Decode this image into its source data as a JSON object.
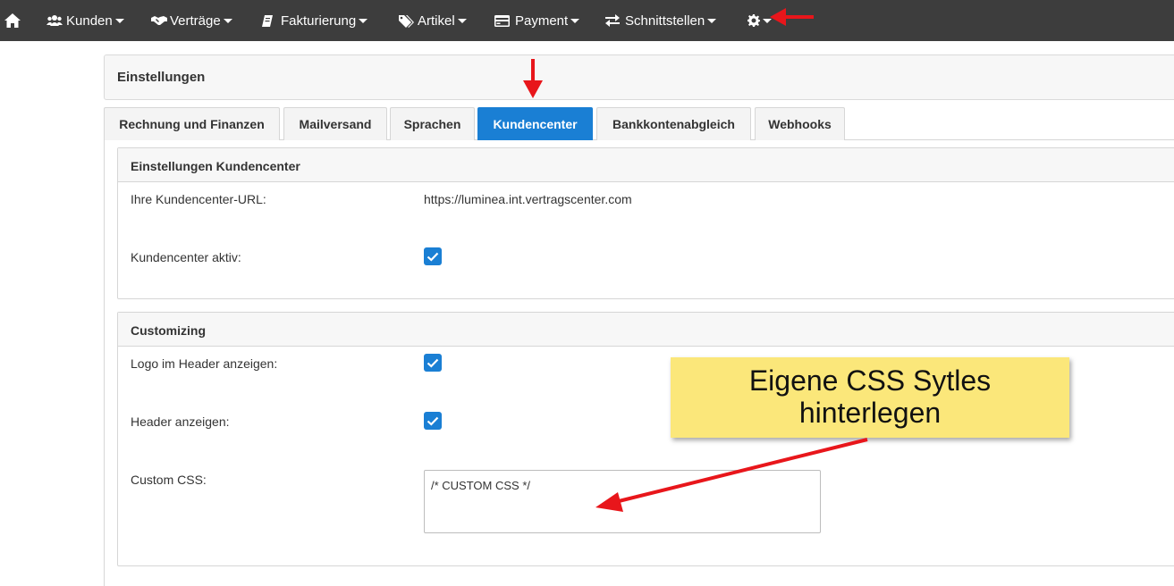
{
  "navbar": {
    "kunden": "Kunden",
    "vertraege": "Verträge",
    "fakturierung": "Fakturierung",
    "artikel": "Artikel",
    "payment": "Payment",
    "schnittstellen": "Schnittstellen"
  },
  "page": {
    "title": "Einstellungen"
  },
  "tabs": [
    {
      "label": "Rechnung und Finanzen",
      "active": false
    },
    {
      "label": "Mailversand",
      "active": false
    },
    {
      "label": "Sprachen",
      "active": false
    },
    {
      "label": "Kundencenter",
      "active": true
    },
    {
      "label": "Bankkontenabgleich",
      "active": false
    },
    {
      "label": "Webhooks",
      "active": false
    }
  ],
  "kundencenter": {
    "heading": "Einstellungen Kundencenter",
    "url_label": "Ihre Kundencenter-URL:",
    "url_value": "https://luminea.int.vertragscenter.com",
    "aktiv_label": "Kundencenter aktiv:",
    "aktiv_checked": true
  },
  "customizing": {
    "heading": "Customizing",
    "logo_label": "Logo im Header anzeigen:",
    "logo_checked": true,
    "header_label": "Header anzeigen:",
    "header_checked": true,
    "css_label": "Custom CSS:",
    "css_value": "/* CUSTOM CSS */"
  },
  "annotation": {
    "line1": "Eigene CSS Sytles",
    "line2": "hinterlegen"
  },
  "colors": {
    "navbar": "#3d3d3d",
    "accent": "#1a7fd4",
    "arrow": "#e8161b",
    "callout": "#fbe77a"
  }
}
